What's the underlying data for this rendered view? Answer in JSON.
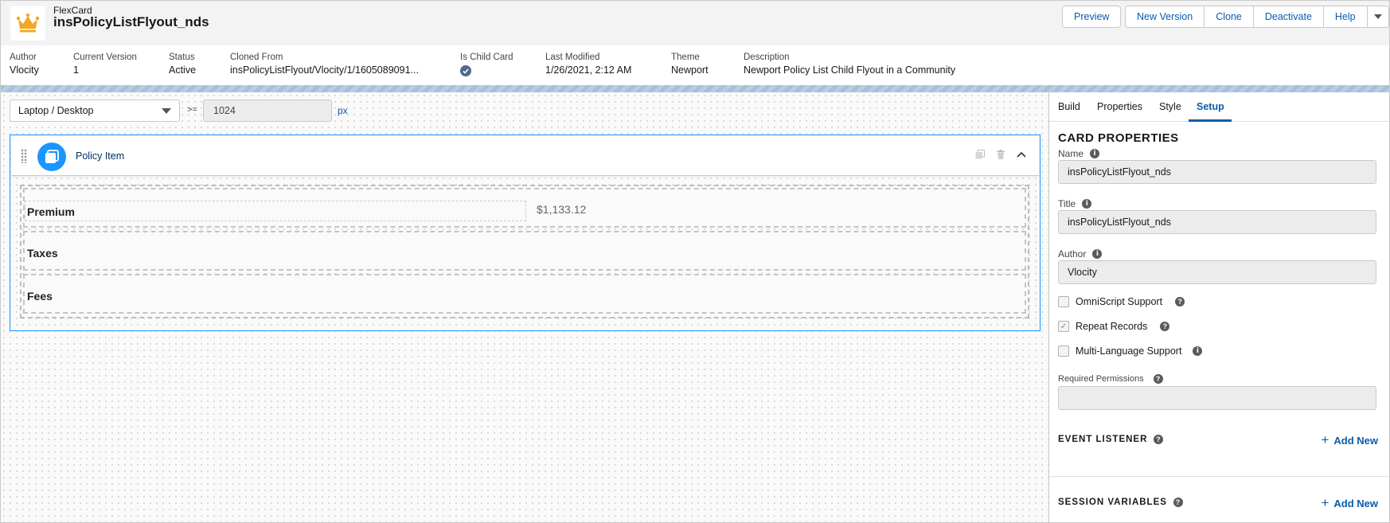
{
  "header": {
    "subtitle": "FlexCard",
    "title": "insPolicyListFlyout_nds",
    "buttons": [
      "Preview",
      "New Version",
      "Clone",
      "Deactivate",
      "Help"
    ]
  },
  "meta": {
    "author": {
      "label": "Author",
      "value": "Vlocity"
    },
    "version": {
      "label": "Current Version",
      "value": "1"
    },
    "status": {
      "label": "Status",
      "value": "Active"
    },
    "cloned": {
      "label": "Cloned From",
      "value": "insPolicyListFlyout/Vlocity/1/1605089091..."
    },
    "child": {
      "label": "Is Child Card"
    },
    "modified": {
      "label": "Last Modified",
      "value": "1/26/2021, 2:12 AM"
    },
    "theme": {
      "label": "Theme",
      "value": "Newport"
    },
    "description": {
      "label": "Description",
      "value": "Newport Policy List Child Flyout in a Community"
    }
  },
  "canvas": {
    "device": "Laptop / Desktop",
    "gte": ">=",
    "width_value": "1024",
    "unit": "px",
    "card_name": "Policy Item",
    "rows": [
      {
        "label": "Premium",
        "value": "$1,133.12"
      },
      {
        "label": "Taxes"
      },
      {
        "label": "Fees"
      }
    ]
  },
  "panel": {
    "tabs": [
      "Build",
      "Properties",
      "Style",
      "Setup"
    ],
    "section_title": "CARD PROPERTIES",
    "name": {
      "label": "Name",
      "value": "insPolicyListFlyout_nds"
    },
    "title": {
      "label": "Title",
      "value": "insPolicyListFlyout_nds"
    },
    "author": {
      "label": "Author",
      "value": "Vlocity"
    },
    "omniscript": "OmniScript Support",
    "repeat": "Repeat Records",
    "multilang": "Multi-Language Support",
    "permissions": {
      "label": "Required Permissions",
      "value": ""
    },
    "event_listener": "EVENT LISTENER",
    "session_variables": "SESSION VARIABLES",
    "add_new": "Add New"
  },
  "colors": {
    "accent": "#0b5cab",
    "card_icon": "#1b96ff",
    "crown": "#f4a623"
  }
}
